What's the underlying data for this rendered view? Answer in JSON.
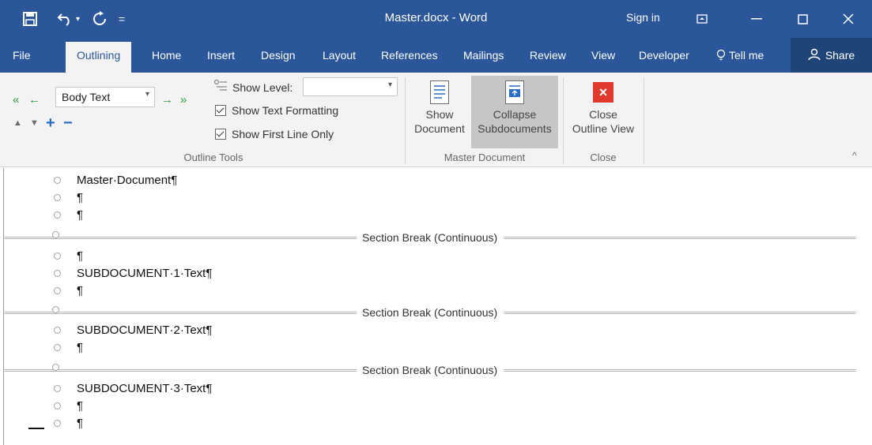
{
  "titlebar": {
    "title": "Master.docx  -  Word",
    "sign_in": "Sign in",
    "save_icon": "save-icon",
    "undo_icon": "undo-icon",
    "redo_icon": "redo-icon"
  },
  "tabs": [
    "File",
    "Outlining",
    "Home",
    "Insert",
    "Design",
    "Layout",
    "References",
    "Mailings",
    "Review",
    "View",
    "Developer",
    "Tell me"
  ],
  "share_label": "Share",
  "ribbon": {
    "outline_tools": {
      "level_value": "Body Text",
      "show_level_label": "Show Level:",
      "show_level_value": "",
      "show_text_formatting": "Show Text Formatting",
      "show_first_line_only": "Show First Line Only",
      "group_label": "Outline Tools"
    },
    "master_document": {
      "show_document_l1": "Show",
      "show_document_l2": "Document",
      "collapse_l1": "Collapse",
      "collapse_l2": "Subdocuments",
      "group_label": "Master Document"
    },
    "close": {
      "close_l1": "Close",
      "close_l2": "Outline View",
      "group_label": "Close"
    }
  },
  "document": {
    "lines": [
      "Master·Document¶",
      "¶",
      "¶",
      "¶",
      "SUBDOCUMENT·1·Text¶",
      "¶",
      "SUBDOCUMENT·2·Text¶",
      "¶",
      "SUBDOCUMENT·3·Text¶",
      "¶",
      "¶"
    ],
    "section_break": "Section Break (Continuous)"
  },
  "colors": {
    "accent": "#2b579a",
    "share_bg": "#1e4478",
    "close_red": "#e03a2e",
    "green_arrow": "#2e9b45",
    "blue_arrow": "#2b6cc4"
  }
}
